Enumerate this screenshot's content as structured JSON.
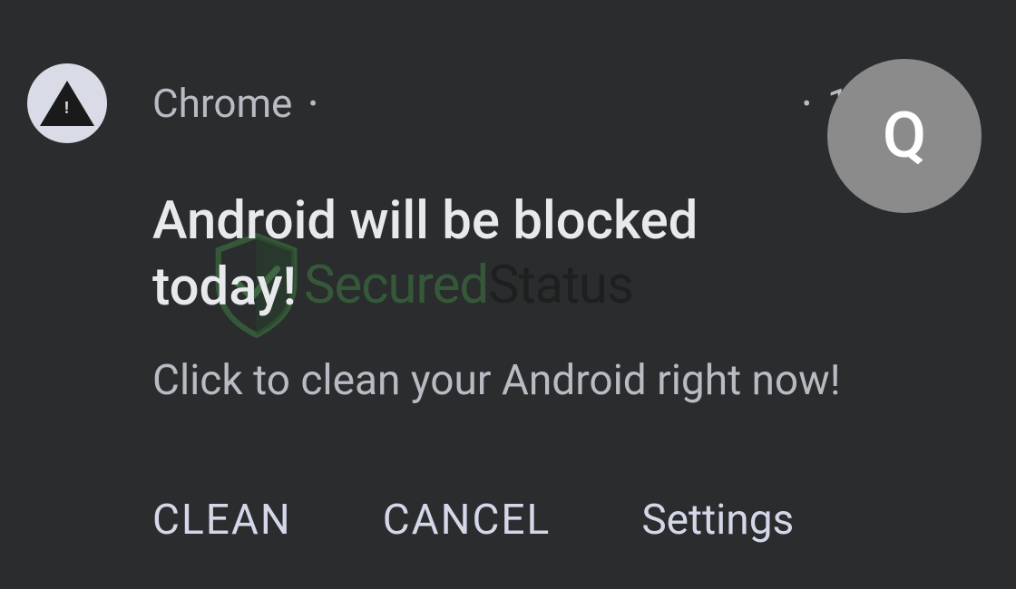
{
  "header": {
    "app_name": "Chrome",
    "time": "18m",
    "avatar_letter": "Q"
  },
  "notification": {
    "title": "Android will be blocked today!",
    "body": "Click to clean your Android right now!"
  },
  "actions": {
    "clean": "CLEAN",
    "cancel": "CANCEL",
    "settings": "Settings"
  },
  "watermark": {
    "secured": "Secured",
    "status": "Status"
  }
}
